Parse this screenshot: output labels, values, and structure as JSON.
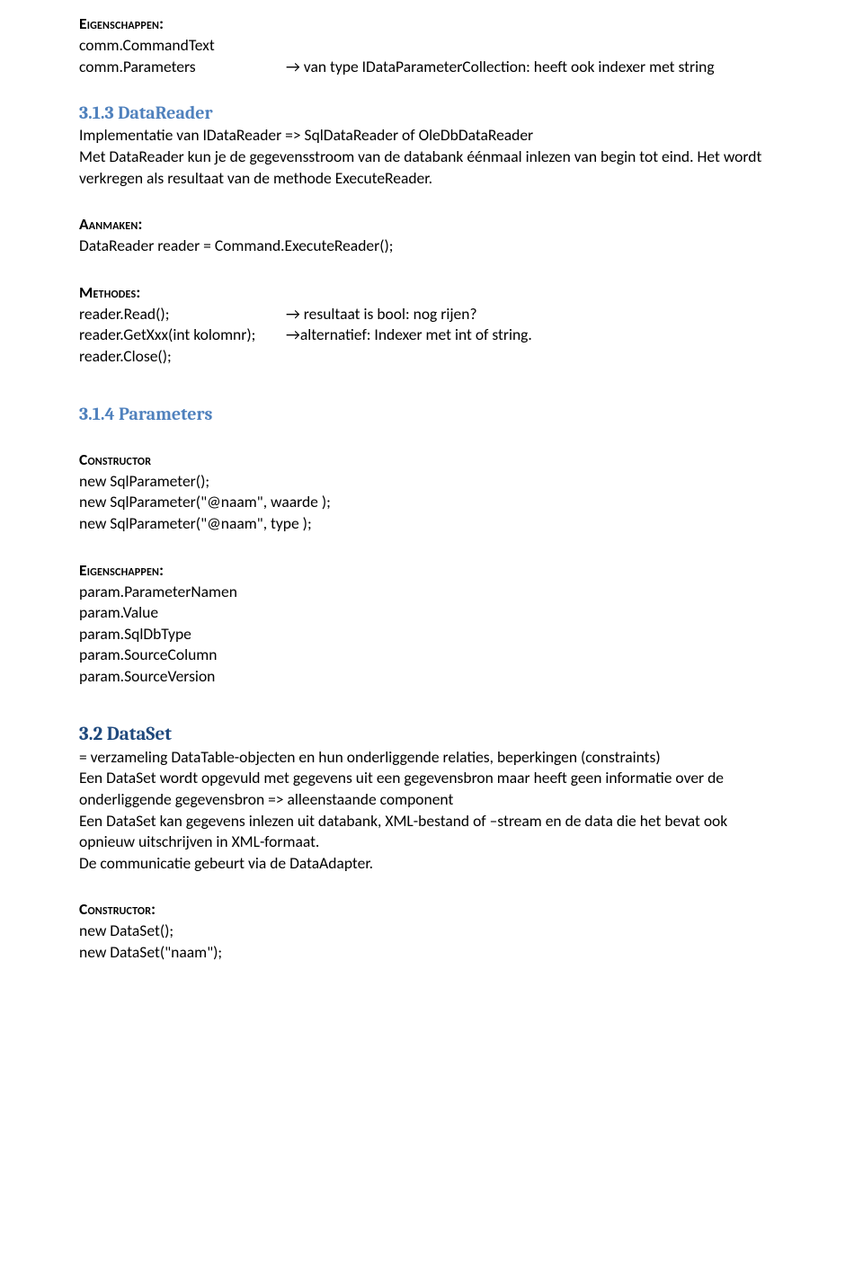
{
  "eig1": {
    "label": "Eigenschappen:",
    "l1": "comm.CommandText",
    "row": {
      "c1": "comm.Parameters",
      "c2": "→ van type IDataParameterCollection: heeft ook indexer met string"
    }
  },
  "h313": "3.1.3 DataReader",
  "datareader_para": "Implementatie van IDataReader => SqlDataReader of OleDbDataReader\nMet DataReader kun je de gegevensstroom van de databank éénmaal inlezen van begin tot eind. Het wordt verkregen als resultaat van de methode ExecuteReader.",
  "aanmaken": {
    "label": "Aanmaken:",
    "l1": "DataReader reader = Command.ExecuteReader();"
  },
  "methodes": {
    "label": "Methodes:",
    "row1": {
      "c1": "reader.Read();",
      "c2": "→ resultaat is bool: nog rijen?"
    },
    "row2": {
      "c1": "reader.GetXxx(int kolomnr);",
      "c2": "→alternatief: Indexer met int of string."
    },
    "l3": "reader.Close();"
  },
  "h314": "3.1.4 Parameters",
  "constructor1": {
    "label": "Constructor",
    "l1": "new SqlParameter();",
    "l2": "new SqlParameter(\"@naam\", waarde );",
    "l3": "new SqlParameter(\"@naam\", type );"
  },
  "eig2": {
    "label": "Eigenschappen:",
    "l1": "param.ParameterNamen",
    "l2": "param.Value",
    "l3": "param.SqlDbType",
    "l4": "param.SourceColumn",
    "l5": "param.SourceVersion"
  },
  "h32": "3.2  DataSet",
  "dataset_para": "= verzameling DataTable-objecten en hun onderliggende relaties, beperkingen (constraints)\nEen DataSet wordt opgevuld met gegevens uit een gegevensbron maar heeft geen informatie over de onderliggende gegevensbron => alleenstaande component\nEen DataSet kan gegevens inlezen uit databank, XML-bestand of –stream en de data die het bevat ook opnieuw uitschrijven in XML-formaat.\nDe communicatie gebeurt via de DataAdapter.",
  "constructor2": {
    "label": "Constructor:",
    "l1": "new DataSet();",
    "l2": "new DataSet(\"naam\");"
  }
}
